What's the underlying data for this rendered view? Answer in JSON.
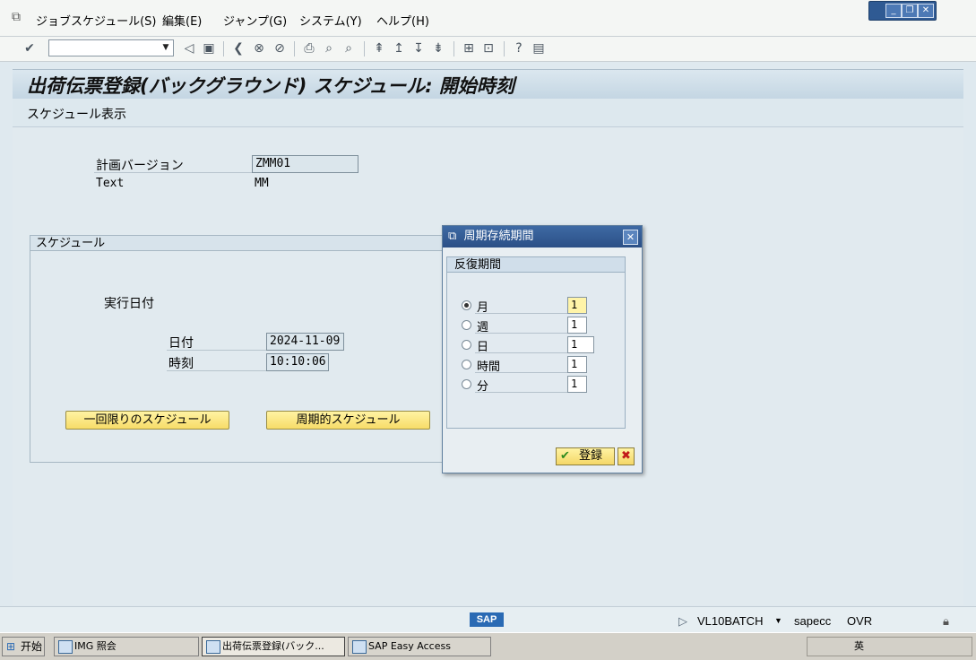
{
  "menubar": {
    "items": [
      "ジョブスケジュール(S)",
      "編集(E)",
      "ジャンプ(G)",
      "システム(Y)",
      "ヘルプ(H)"
    ]
  },
  "window_controls": {
    "minimize": "_",
    "restore": "❐",
    "close": "✕"
  },
  "toolbar": {
    "command_field_value": ""
  },
  "header": {
    "title": "出荷伝票登録(バックグラウンド) スケジュール: 開始時刻",
    "subtitle": "スケジュール表示"
  },
  "main": {
    "plan_version_label": "計画バージョン",
    "plan_version_value": "ZMM01",
    "text_label": "Text",
    "text_value": "MM",
    "schedule_frame_title": "スケジュール",
    "execution_date_label": "実行日付",
    "date_label": "日付",
    "date_value": "2024-11-09",
    "time_label": "時刻",
    "time_value": "10:10:06",
    "one_time_button": "一回限りのスケジュール",
    "periodic_button": "周期的スケジュール"
  },
  "dialog": {
    "title": "周期存続期間",
    "frame_title": "反復期間",
    "options": [
      {
        "label": "月",
        "value": "1",
        "selected": true
      },
      {
        "label": "週",
        "value": "1",
        "selected": false
      },
      {
        "label": "日",
        "value": "1",
        "selected": false
      },
      {
        "label": "時間",
        "value": "1",
        "selected": false
      },
      {
        "label": "分",
        "value": "1",
        "selected": false
      }
    ],
    "ok_label": "登録",
    "cancel_symbol": "✖"
  },
  "statusbar": {
    "logo": "SAP",
    "session": "VL10BATCH",
    "server": "sapecc",
    "mode": "OVR"
  },
  "taskbar": {
    "start": "开始",
    "tasks": [
      "IMG 照会",
      "出荷伝票登録(バック...",
      "SAP Easy Access"
    ],
    "tray": "英"
  },
  "colors": {
    "title_bar": "#2b4f86",
    "button_yellow": "#f7dc68",
    "sap_blue": "#2a6ab4"
  }
}
